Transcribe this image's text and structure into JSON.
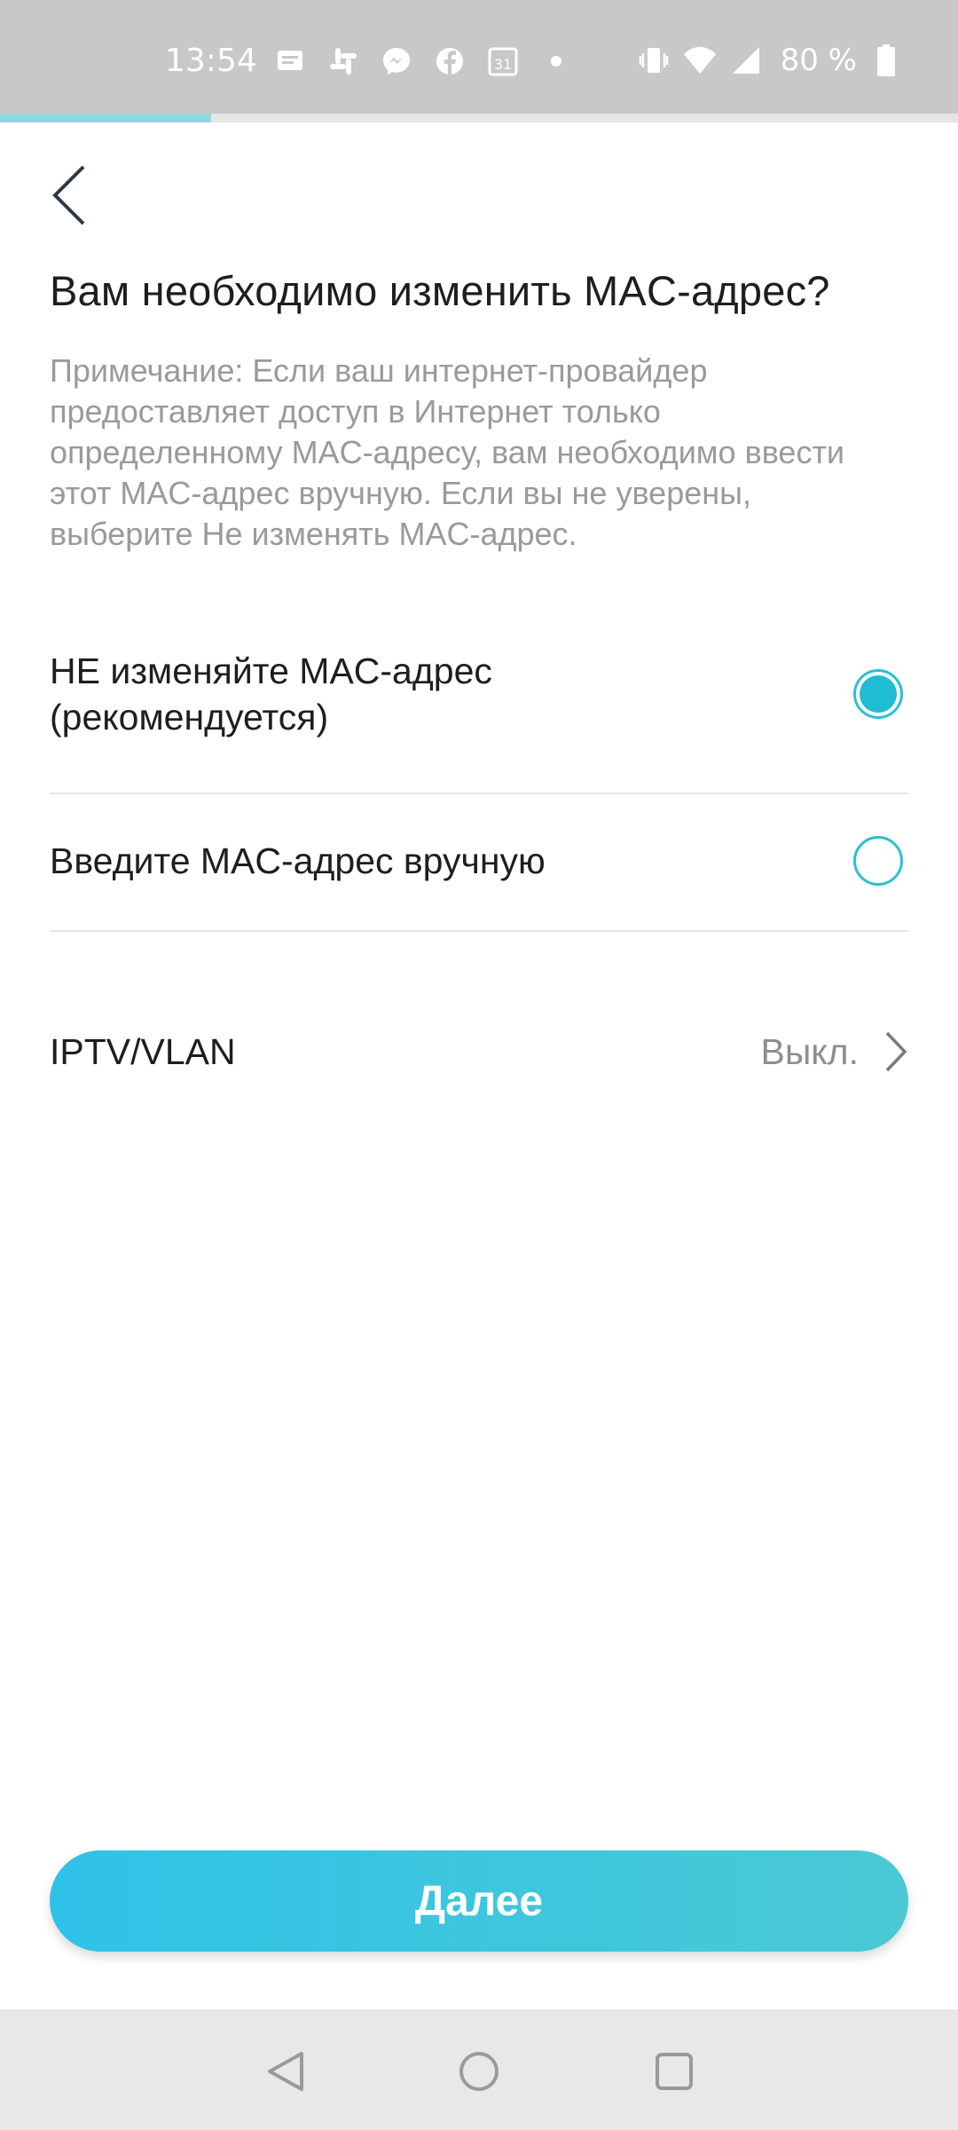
{
  "status_bar": {
    "time": "13:54",
    "battery": "80 %",
    "icons_left": [
      "message-icon",
      "slack-icon",
      "messenger-icon",
      "facebook-icon",
      "calendar-icon",
      "dot-icon"
    ],
    "calendar_day": "31",
    "icons_right": [
      "vibrate-icon",
      "wifi-icon",
      "signal-icon",
      "battery-icon"
    ]
  },
  "progress": {
    "fraction": 0.22,
    "color": "#8fd9e2"
  },
  "header": {
    "back_icon": "chevron-left-icon"
  },
  "title": "Вам необходимо изменить MAC-адрес?",
  "note": "Примечание: Если ваш интернет-провайдер предоставляет доступ в Интернет только определенному MAC-адресу, вам необходимо ввести этот MAC-адрес вручную. Если вы не уверены, выберите Не изменять MAC-адрес.",
  "options": [
    {
      "label": "НЕ изменяйте MAC-адрес (рекомендуется)",
      "selected": true
    },
    {
      "label": "Введите MAC-адрес вручную",
      "selected": false
    }
  ],
  "iptv": {
    "label": "IPTV/VLAN",
    "value": "Выкл."
  },
  "next_button": {
    "label": "Далее"
  },
  "colors": {
    "accent": "#1fbcd2",
    "button_start": "#2fc2e8",
    "button_end": "#4ac9d4"
  },
  "nav_bar": {
    "icons": [
      "back-triangle-icon",
      "home-circle-icon",
      "recents-square-icon"
    ]
  }
}
